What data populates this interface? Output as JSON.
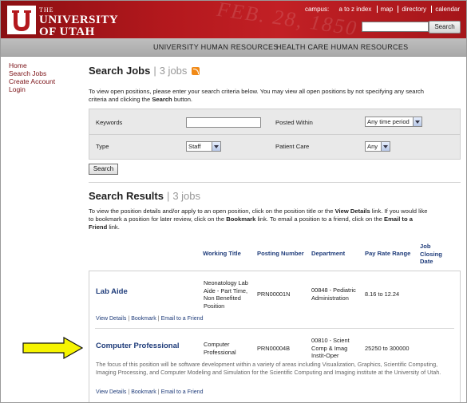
{
  "header": {
    "logo_the": "THE",
    "logo_university": "UNIVERSITY",
    "logo_of_utah": "OF UTAH",
    "watermark": "FEB. 28, 1850",
    "campus_label": "campus:",
    "top_links": [
      "a to z index",
      "map",
      "directory",
      "calendar"
    ],
    "search_button": "Search"
  },
  "nav": {
    "items": [
      "UNIVERSITY HUMAN RESOURCES",
      "HEALTH CARE HUMAN RESOURCES"
    ]
  },
  "sidebar": {
    "items": [
      "Home",
      "Search Jobs",
      "Create Account",
      "Login"
    ]
  },
  "search_jobs": {
    "title": "Search Jobs",
    "count": "3 jobs",
    "intro_a": "To view open positions, please enter your search criteria below.  You may view all open positions by not specifying any search",
    "intro_b": "criteria and clicking the ",
    "intro_b_bold": "Search",
    "intro_b_end": " button.",
    "keywords_label": "Keywords",
    "keywords_value": "",
    "posted_within_label": "Posted Within",
    "posted_within_value": "Any time period",
    "type_label": "Type",
    "type_value": "Staff",
    "patient_care_label": "Patient Care",
    "patient_care_value": "Any",
    "search_button": "Search"
  },
  "results": {
    "title": "Search Results",
    "count": "3 jobs",
    "instr_1a": "To view the position details and/or apply to an open position, click on the position title or the ",
    "instr_1b": "View Details",
    "instr_1c": " link.  If you would like",
    "instr_2a": "to bookmark a position for later review, click on the ",
    "instr_2b": "Bookmark",
    "instr_2c": " link. To email a position to a friend, click on the ",
    "instr_2d": "Email to a",
    "instr_3a": "Friend",
    "instr_3b": " link.",
    "columns": [
      "Working Title",
      "Posting Number",
      "Department",
      "Pay Rate Range",
      "Job Closing Date"
    ],
    "jobs": [
      {
        "title": "Lab Aide",
        "working_title": [
          "Neonatology Lab",
          "Aide - Part Time,",
          "Non Benefited",
          "Position"
        ],
        "posting_number": "PRN00001N",
        "department": [
          "00848 - Pediatric",
          "Administration"
        ],
        "pay_rate": "8.16 to 12.24"
      },
      {
        "title": "Computer Professional",
        "working_title": [
          "Computer",
          "Professional"
        ],
        "posting_number": "PRN00004B",
        "department": [
          "00810 - Scient",
          "Comp & Imag",
          "Instit-Oper"
        ],
        "pay_rate": "25250 to 300000",
        "description": "The focus of this position will be software development within a variety of areas including Visualization, Graphics, Scientific Computing, Imaging Processing, and Computer Modeling and Simulation for the Scientific Computing and Imaging institute at the University of Utah."
      }
    ],
    "row_links": [
      "View Details",
      "Bookmark",
      "Email to a Friend"
    ]
  },
  "colors": {
    "header_red": "#b3181d",
    "link_blue": "#1f3c7a",
    "arrow_yellow": "#f6f400"
  }
}
